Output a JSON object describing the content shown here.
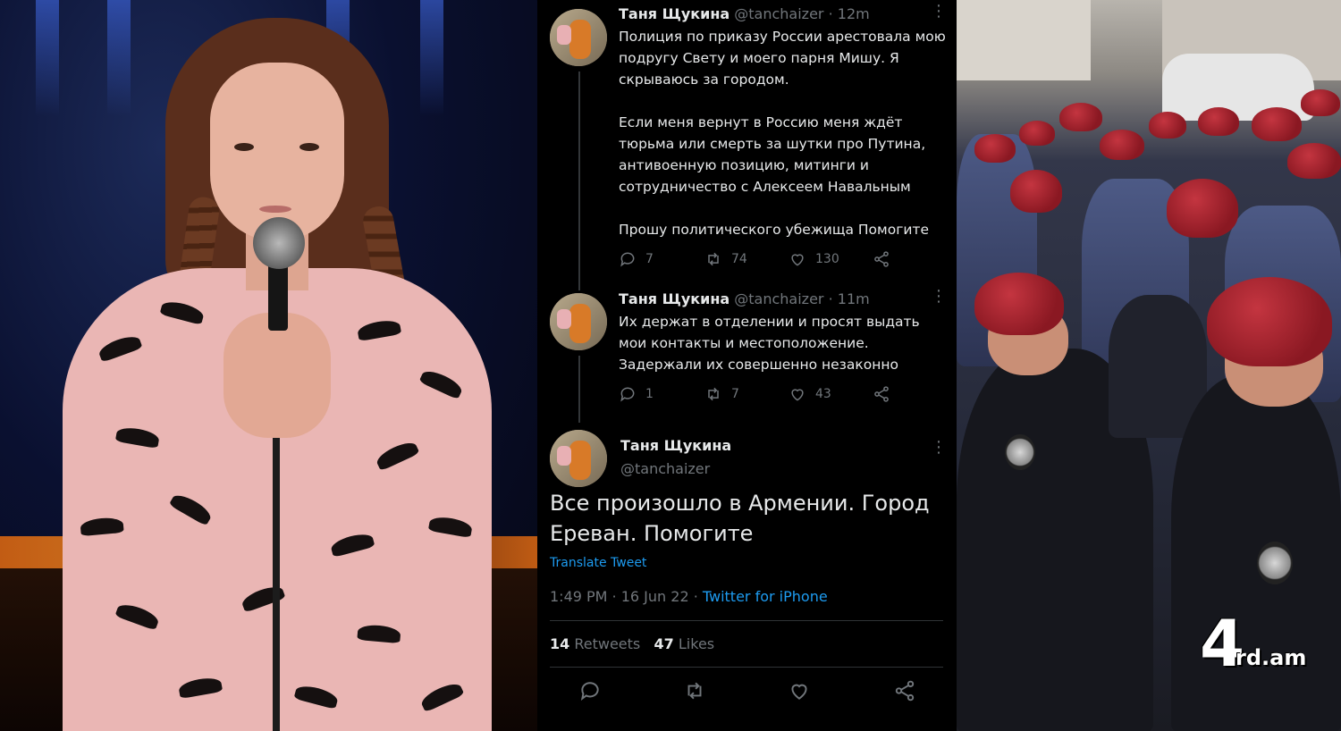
{
  "tweets": [
    {
      "name": "Таня Щукина",
      "handle": "@tanchaizer",
      "time": "· 12m",
      "paragraphs": [
        "Полиция по приказу России арестовала мою подругу Свету и моего парня Мишу. Я скрываюсь за городом.",
        "Если меня вернут в Россию меня ждёт тюрьма или смерть за шутки про Путина, антивоенную позицию, митинги и сотрудничество с Алексеем Навальным",
        "Прошу политического убежища Помогите"
      ],
      "replies": "7",
      "retweets": "74",
      "likes": "130"
    },
    {
      "name": "Таня Щукина",
      "handle": "@tanchaizer",
      "time": "· 11m",
      "paragraphs": [
        "Их держат в отделении и просят выдать мои контакты и местоположение. Задержали их совершенно незаконно"
      ],
      "replies": "1",
      "retweets": "7",
      "likes": "43"
    }
  ],
  "main_tweet": {
    "name": "Таня Щукина",
    "handle": "@tanchaizer",
    "text": "Все произошло в Армении. Город Ереван. Помогите",
    "translate": "Translate Tweet",
    "timestamp": "1:49 PM · 16 Jun 22 · ",
    "source": "Twitter for iPhone",
    "retweets_count": "14",
    "retweets_label": "Retweets",
    "likes_count": "47",
    "likes_label": "Likes"
  },
  "watermark": {
    "big": "4",
    "small": "rd.am"
  },
  "colors": {
    "background": "#000000",
    "text": "#e7e9ea",
    "muted": "#71767b",
    "link": "#1d9bf0"
  },
  "icons": [
    "reply-icon",
    "retweet-icon",
    "like-icon",
    "share-icon",
    "more-icon"
  ]
}
